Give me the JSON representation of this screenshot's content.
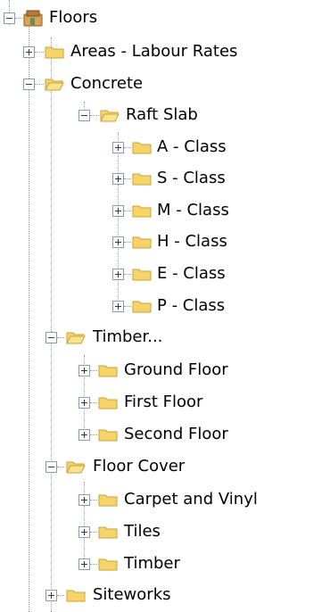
{
  "tree": {
    "root": {
      "label": "Floors",
      "icon": "floors-icon",
      "expanded": true
    },
    "nodes": [
      {
        "id": "areas-labour-rates",
        "label": "Areas - Labour Rates",
        "expanded": false
      },
      {
        "id": "concrete",
        "label": "Concrete",
        "expanded": true
      },
      {
        "id": "raft-slab",
        "label": "Raft Slab",
        "expanded": true
      },
      {
        "id": "a-class",
        "label": "A - Class",
        "expanded": false
      },
      {
        "id": "s-class",
        "label": "S - Class",
        "expanded": false
      },
      {
        "id": "m-class",
        "label": "M - Class",
        "expanded": false
      },
      {
        "id": "h-class",
        "label": "H - Class",
        "expanded": false
      },
      {
        "id": "e-class",
        "label": "E - Class",
        "expanded": false
      },
      {
        "id": "p-class",
        "label": "P - Class",
        "expanded": false
      },
      {
        "id": "timber",
        "label": "Timber...",
        "expanded": true
      },
      {
        "id": "ground-floor",
        "label": "Ground Floor",
        "expanded": false
      },
      {
        "id": "first-floor",
        "label": "First Floor",
        "expanded": false
      },
      {
        "id": "second-floor",
        "label": "Second Floor",
        "expanded": false
      },
      {
        "id": "floor-cover",
        "label": "Floor Cover",
        "expanded": true
      },
      {
        "id": "carpet-and-vinyl",
        "label": "Carpet and Vinyl",
        "expanded": false
      },
      {
        "id": "tiles",
        "label": "Tiles",
        "expanded": false
      },
      {
        "id": "timber-cover",
        "label": "Timber",
        "expanded": false
      },
      {
        "id": "siteworks",
        "label": "Siteworks",
        "expanded": false
      }
    ]
  },
  "colors": {
    "folder_fill": "#f6d46a",
    "folder_edge": "#c9a13a",
    "folder_open_fill": "#fbe291",
    "connector": "#9a9a9a",
    "expander_border": "#8e9aa8",
    "root_icon": "#c8863a"
  }
}
